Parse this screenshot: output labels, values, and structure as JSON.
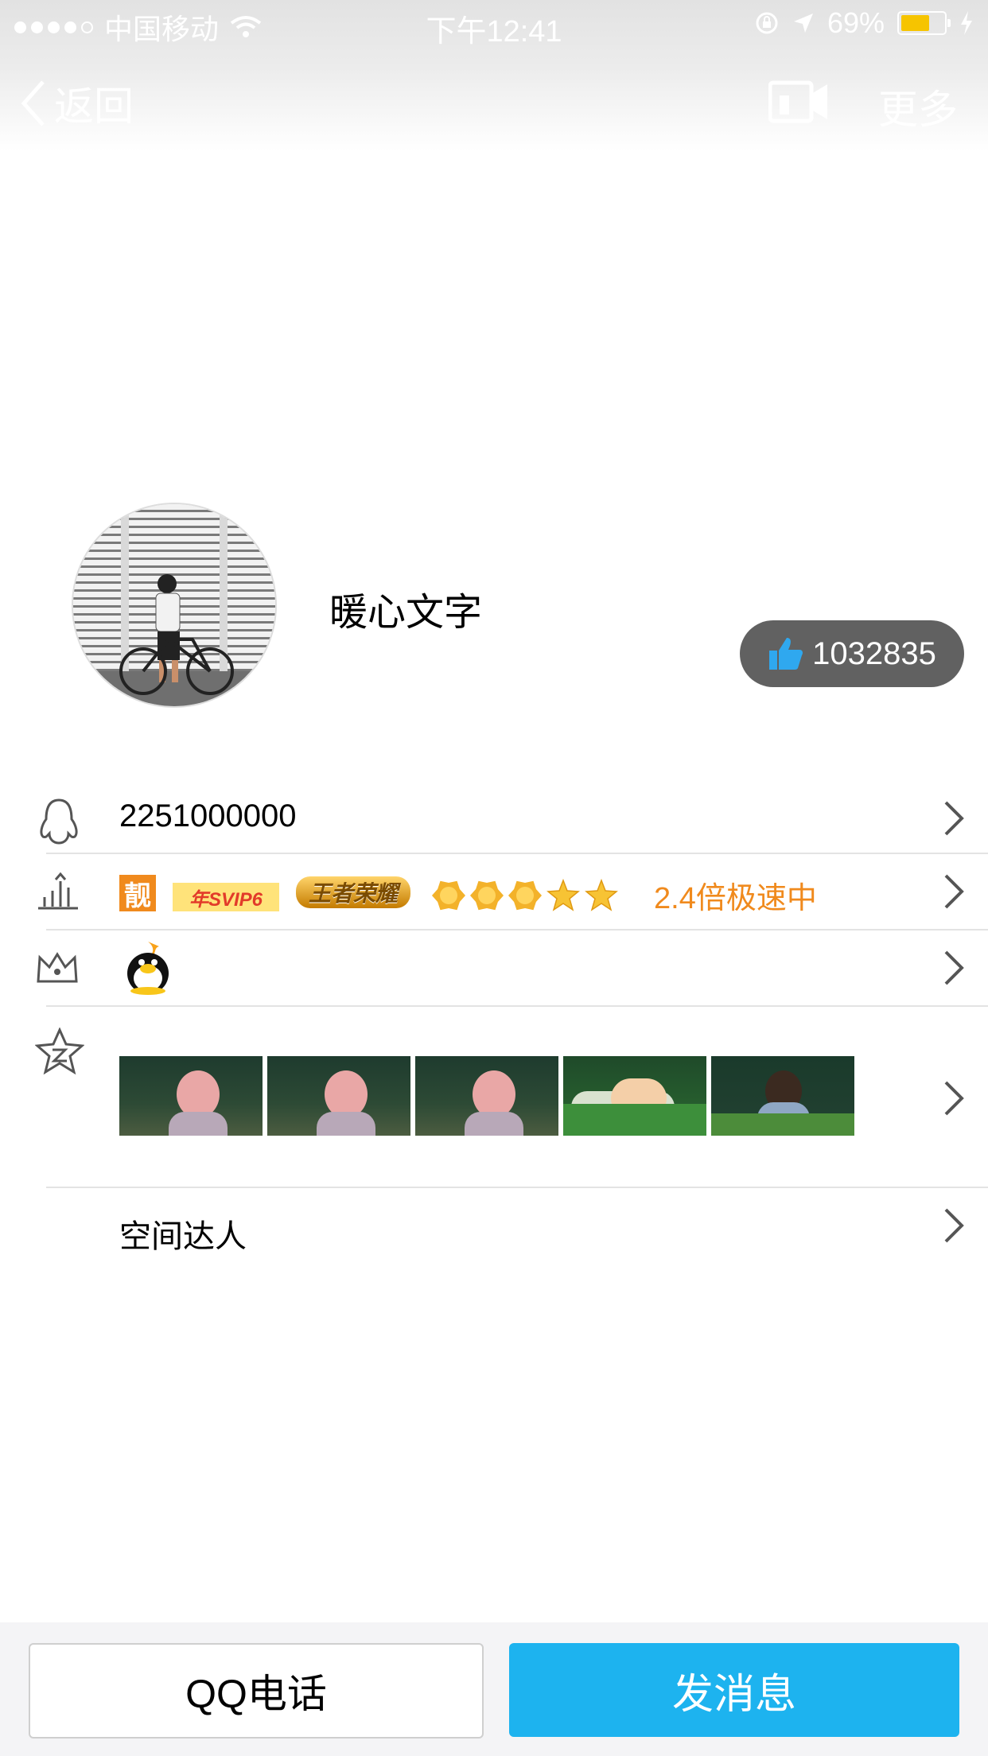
{
  "status_bar": {
    "carrier": "中国移动",
    "time": "下午12:41",
    "battery_percent": "69%",
    "battery_level": 0.69
  },
  "nav": {
    "back_label": "返回",
    "more_label": "更多"
  },
  "profile": {
    "nickname": "暖心文字",
    "like_count": "1032835"
  },
  "rows": {
    "qq_number": "2251000000",
    "badges": {
      "liang": "靓",
      "svip": "年SVIP6",
      "game": "王者荣耀",
      "crown_count": 3,
      "star_count": 2,
      "speed_text": "2.4倍极速中"
    },
    "talent_label": "空间达人"
  },
  "bottom": {
    "call_label": "QQ电话",
    "message_label": "发消息"
  },
  "colors": {
    "accent": "#1db3ef",
    "orange": "#f08a1d",
    "like_pill": "#616161"
  }
}
